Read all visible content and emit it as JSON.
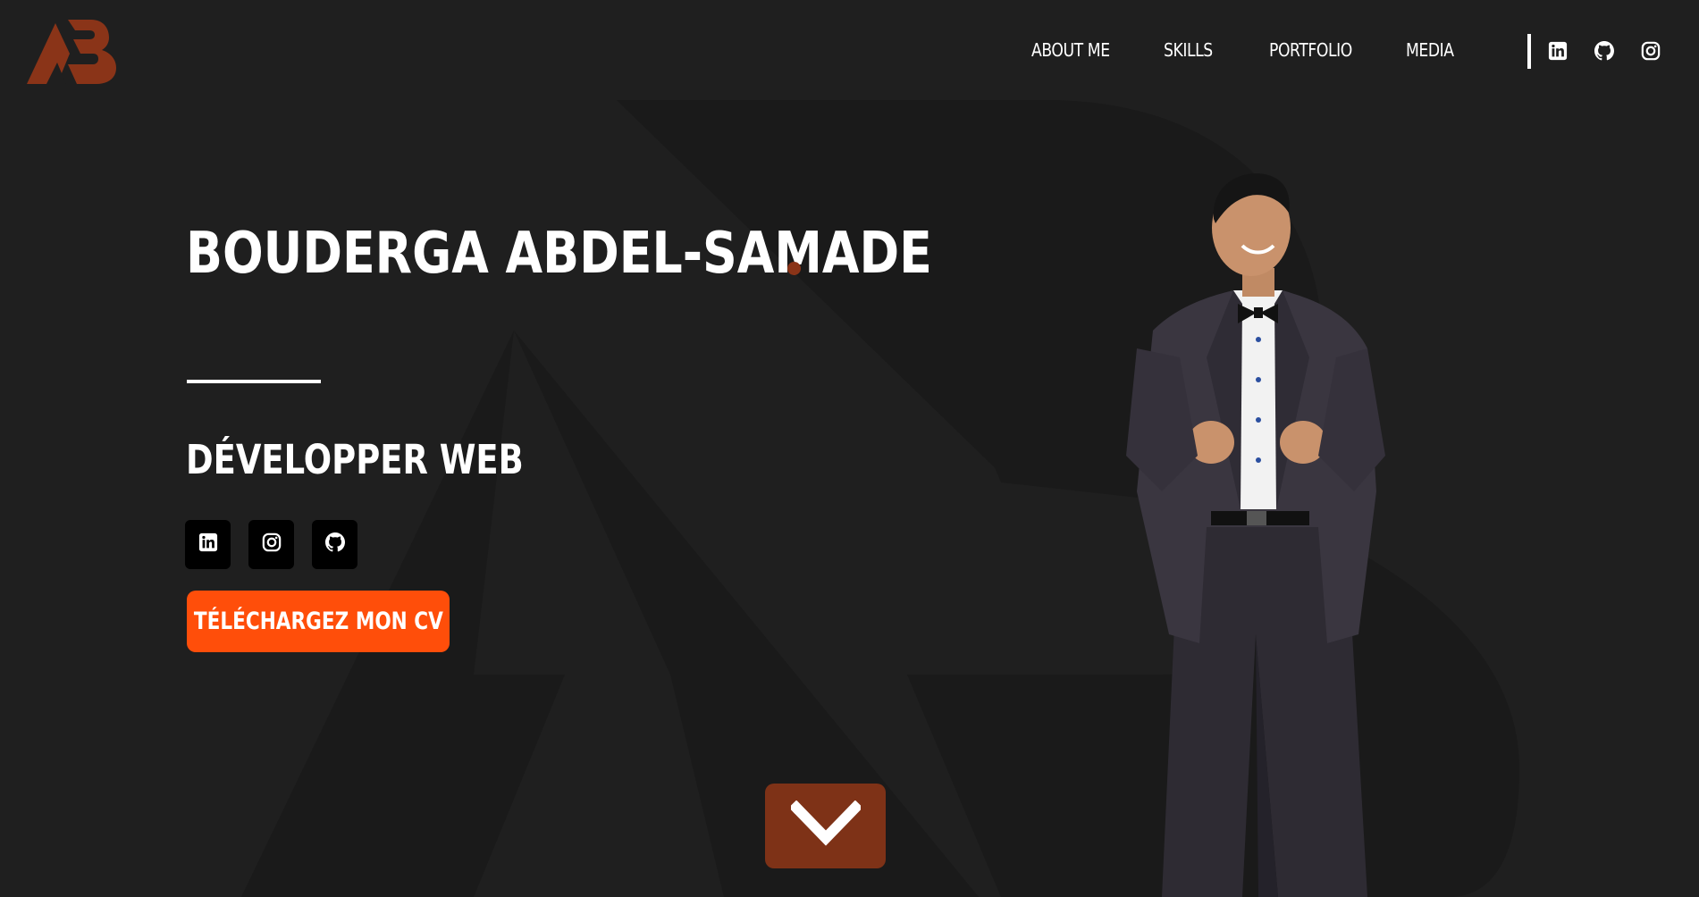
{
  "brand": {
    "logo_text": "AB",
    "accent_color": "#8a3418",
    "button_color": "#ff4e0a",
    "scroll_button_color": "#7e3217",
    "background_color": "#1f1f1f"
  },
  "nav": {
    "items": [
      {
        "label": "ABOUT ME"
      },
      {
        "label": "SKILLS"
      },
      {
        "label": "PORTFOLIO"
      },
      {
        "label": "MEDIA"
      }
    ],
    "icons": [
      "linkedin-icon",
      "github-icon",
      "instagram-icon"
    ]
  },
  "hero": {
    "name": "BOUDERGA ABDEL-SAMADE",
    "title": "DÉVELOPPER WEB",
    "social_icons": [
      "linkedin-icon",
      "instagram-icon",
      "github-icon"
    ],
    "cv_button_label": "TÉLÉCHARGEZ MON CV",
    "scroll_icon": "chevron-down-icon"
  }
}
